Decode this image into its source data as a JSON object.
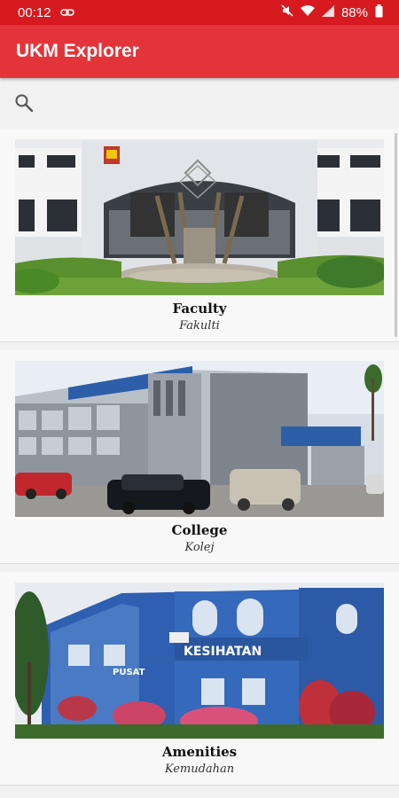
{
  "status_bar": {
    "time": "00:12",
    "battery": "88%"
  },
  "app": {
    "title": "UKM Explorer"
  },
  "search": {
    "icon": "search-icon"
  },
  "categories": [
    {
      "title": "Faculty",
      "subtitle": "Fakulti"
    },
    {
      "title": "College",
      "subtitle": "Kolej"
    },
    {
      "title": "Amenities",
      "subtitle": "Kemudahan"
    }
  ],
  "colors": {
    "status_bar": "#d71920",
    "app_bar": "#e3343a"
  }
}
